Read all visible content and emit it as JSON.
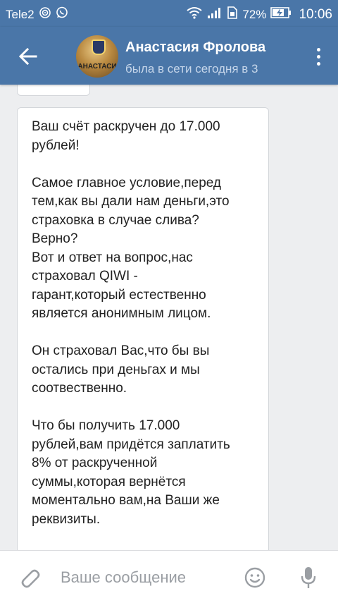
{
  "status_bar": {
    "carrier": "Tele2",
    "battery": "72%",
    "time": "10:06"
  },
  "header": {
    "contact_name": "Анастасия Фролова",
    "contact_status": "была в сети сегодня в 3",
    "avatar_text": "АНАСТАСИ"
  },
  "message": {
    "text": "Ваш счёт раскручен до 17.000\nрублей!\n\nСамое главное условие,перед\nтем,как вы дали нам деньги,это\nстраховка в случае слива?\nВерно?\nВот и ответ на вопрос,нас\nстраховал QIWI -\nгарант,который естественно\nявляется анонимным лицом.\n\nОн страховал Вас,что бы вы\nостались при деньгах и мы\nсоотвественно.\n\nЧто бы получить 17.000\nрублей,вам придётся заплатить\n8% от раскрученной\nсуммы,которая вернётся\nмоментально вам,на Ваши же\nреквизиты.\n\nРеквизиты гаранта. При\nперевод в комментарии\nуказать: Киви/карту и номер"
  },
  "input": {
    "placeholder": "Ваше сообщение"
  },
  "icons": {
    "back": "arrow-left-icon",
    "more": "more-vert-icon",
    "attach": "paperclip-icon",
    "emoji": "smiley-icon",
    "mic": "microphone-icon"
  },
  "colors": {
    "header_bg": "#4a76a8",
    "chat_bg": "#edeef0",
    "bubble_bg": "#ffffff",
    "status_text": "#c6d6ea"
  }
}
